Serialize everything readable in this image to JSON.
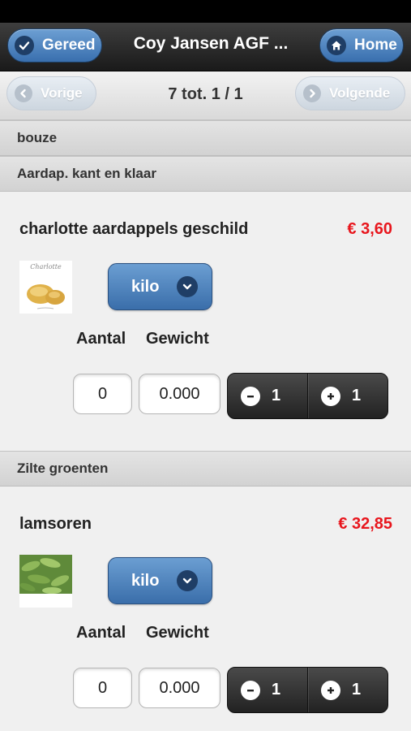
{
  "header": {
    "done_label": "Gereed",
    "title": "Coy Jansen AGF ...",
    "home_label": "Home"
  },
  "pager": {
    "prev_label": "Vorige",
    "status": "7 tot. 1 / 1",
    "next_label": "Volgende"
  },
  "category": "bouze",
  "groups": [
    {
      "title": "Aardap. kant en klaar",
      "product": {
        "name": "charlotte aardappels geschild",
        "price": "€ 3,60",
        "thumb_caption": "Charlotte",
        "unit": "kilo",
        "quantity_label": "Aantal",
        "weight_label": "Gewicht",
        "quantity": "0",
        "weight": "0.000",
        "decrement": "1",
        "increment": "1"
      }
    },
    {
      "title": "Zilte groenten",
      "product": {
        "name": "lamsoren",
        "price": "€ 32,85",
        "unit": "kilo",
        "quantity_label": "Aantal",
        "weight_label": "Gewicht",
        "quantity": "0",
        "weight": "0.000",
        "decrement": "1",
        "increment": "1"
      }
    }
  ],
  "colors": {
    "price": "#e8161d",
    "button_blue": "#4a80bf",
    "stepper": "#2e2e2e"
  },
  "icons": {
    "done": "check-icon",
    "home": "home-icon",
    "prev": "chevron-left-icon",
    "next": "chevron-right-icon",
    "select": "chevron-down-icon",
    "minus": "minus-icon",
    "plus": "plus-icon"
  }
}
